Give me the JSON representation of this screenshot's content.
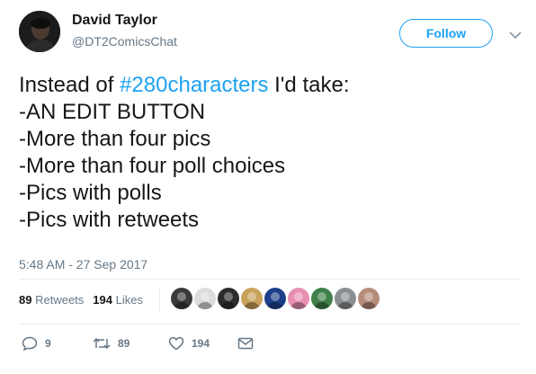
{
  "user": {
    "display_name": "David Taylor",
    "handle": "@DT2ComicsChat",
    "follow_label": "Follow"
  },
  "tweet": {
    "lines": [
      {
        "prefix": "Instead of ",
        "hashtag": "#280characters",
        "suffix": " I'd take:"
      },
      {
        "text": "-AN EDIT BUTTON"
      },
      {
        "text": "-More than four pics"
      },
      {
        "text": "-More than four poll choices"
      },
      {
        "text": "-Pics with polls"
      },
      {
        "text": "-Pics with retweets"
      }
    ],
    "timestamp": "5:48 AM - 27 Sep 2017"
  },
  "stats": {
    "retweets_count": "89",
    "retweets_label": "Retweets",
    "likes_count": "194",
    "likes_label": "Likes"
  },
  "likers": [
    {
      "icon": "avatar-dark-figure",
      "color": "#3a3a3a"
    },
    {
      "icon": "avatar-sketch-face",
      "color": "#dcdcdc"
    },
    {
      "icon": "avatar-dark-portrait",
      "color": "#2c2c2c"
    },
    {
      "icon": "avatar-stack-yellow",
      "color": "#c9a25c"
    },
    {
      "icon": "avatar-superhero-badge",
      "color": "#1d3f8a"
    },
    {
      "icon": "avatar-pink-character",
      "color": "#e78fb3"
    },
    {
      "icon": "avatar-green-character",
      "color": "#3f7f4a"
    },
    {
      "icon": "avatar-grey-portrait",
      "color": "#8a8d91"
    },
    {
      "icon": "avatar-woman-portrait",
      "color": "#b58d7a"
    }
  ],
  "actions": {
    "reply_count": "9",
    "retweet_count": "89",
    "like_count": "194"
  },
  "colors": {
    "accent": "#1da1f2",
    "text": "#14171a",
    "muted": "#657786",
    "divider": "#e6ecf0"
  }
}
